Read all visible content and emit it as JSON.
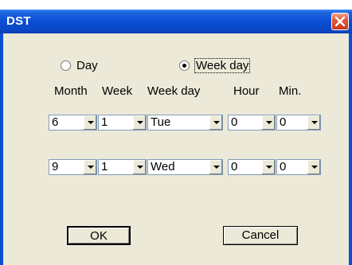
{
  "window": {
    "title": "DST"
  },
  "mode": {
    "options": [
      {
        "label": "Day",
        "checked": false
      },
      {
        "label": "Week day",
        "checked": true
      }
    ]
  },
  "columns": [
    "Month",
    "Week",
    "Week day",
    "Hour",
    "Min."
  ],
  "start": {
    "month": "6",
    "week": "1",
    "weekday": "Tue",
    "hour": "0",
    "min": "0"
  },
  "end": {
    "month": "9",
    "week": "1",
    "weekday": "Wed",
    "hour": "0",
    "min": "0"
  },
  "buttons": {
    "ok": "OK",
    "cancel": "Cancel"
  }
}
